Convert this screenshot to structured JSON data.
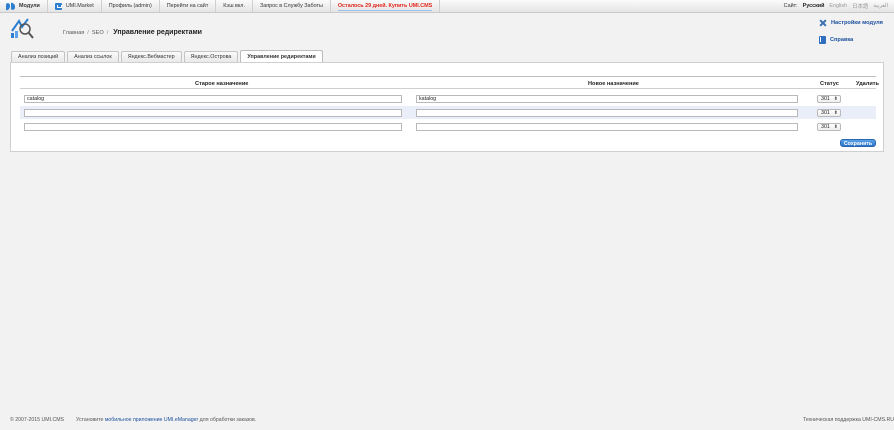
{
  "topbar": {
    "modules_label": "Модули",
    "market_label": "UMI.Market",
    "profile_label": "Профиль (admin)",
    "goto_site_label": "Перейти на сайт",
    "cache_label": "Кэш вкл.",
    "support_label": "Запрос в Службу Заботы",
    "promo_label": "Осталось 29 дней. Купить UMI.CMS",
    "site_label": "Сайт:",
    "languages": [
      "Русский",
      "English",
      "日本語",
      "العربية"
    ]
  },
  "breadcrumb": {
    "home": "Главная",
    "seo": "SEO",
    "current": "Управление редиректами"
  },
  "side_links": {
    "module_settings": "Настройки модуля",
    "help": "Справка"
  },
  "tabs": [
    {
      "label": "Анализ позиций"
    },
    {
      "label": "Анализ ссылок"
    },
    {
      "label": "Яндекс.Вебмастер"
    },
    {
      "label": "Яндекс.Острова"
    },
    {
      "label": "Управление редиректами"
    }
  ],
  "table": {
    "headers": {
      "old": "Старое назначение",
      "new": "Новое назначение",
      "status": "Статус",
      "delete": "Удалить"
    },
    "rows": [
      {
        "old": "catalog",
        "new": "katalog",
        "status": "301"
      },
      {
        "old": "",
        "new": "",
        "status": "301"
      },
      {
        "old": "",
        "new": "",
        "status": "301"
      }
    ]
  },
  "save_label": "Сохранить",
  "footer": {
    "copyright": "© 2007-2015 UMI.CMS",
    "install_prefix": "Установите",
    "install_link": "мобильное приложение UMI.eManager",
    "install_suffix": "для обработки заказов.",
    "support": "Техническая поддержка UMI-CMS.RU"
  },
  "colors": {
    "accent": "#2f7fd0",
    "promo": "#e0261b",
    "alt_row": "#e9eef8"
  }
}
